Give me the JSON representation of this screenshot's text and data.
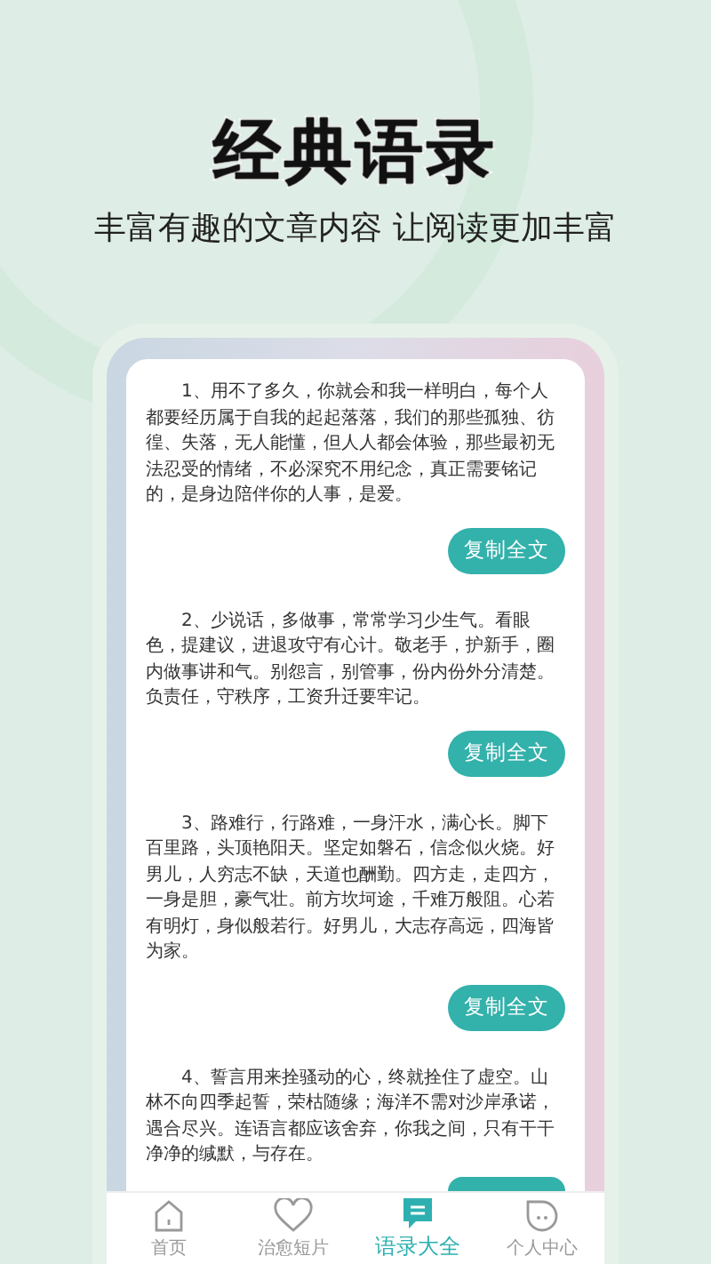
{
  "title": "经典语录",
  "subtitle": "丰富有趣的文章内容 让阅读更加丰富",
  "quotes": [
    {
      "text": "1、用不了多久，你就会和我一样明白，每个人都要经历属于自我的起起落落，我们的那些孤独、彷徨、失落，无人能懂，但人人都会体验，那些最初无法忍受的情绪，不必深究不用纪念，真正需要铭记的，是身边陪伴你的人事，是爱。",
      "copy_label": "复制全文"
    },
    {
      "text": "2、少说话，多做事，常常学习少生气。看眼色，提建议，进退攻守有心计。敬老手，护新手，圈内做事讲和气。别怨言，别管事，份内份外分清楚。负责任，守秩序，工资升迁要牢记。",
      "copy_label": "复制全文"
    },
    {
      "text": "3、路难行，行路难，一身汗水，满心长。脚下百里路，头顶艳阳天。坚定如磐石，信念似火烧。好男儿，人穷志不缺，天道也酬勤。四方走，走四方，一身是胆，豪气壮。前方坎坷途，千难万般阻。心若有明灯，身似般若行。好男儿，大志存高远，四海皆为家。",
      "copy_label": "复制全文"
    },
    {
      "text": "4、誓言用来拴骚动的心，终就拴住了虚空。山林不向四季起誓，荣枯随缘；海洋不需对沙岸承诺，遇合尽兴。连语言都应该舍弃，你我之间，只有干干净净的缄默，与存在。"
    }
  ],
  "tabs": [
    {
      "label": "首页",
      "kind": "home",
      "selected": false
    },
    {
      "label": "治愈短片",
      "kind": "heart",
      "selected": false
    },
    {
      "label": "语录大全",
      "kind": "chat",
      "selected": true
    },
    {
      "label": "个人中心",
      "kind": "face",
      "selected": false
    }
  ]
}
